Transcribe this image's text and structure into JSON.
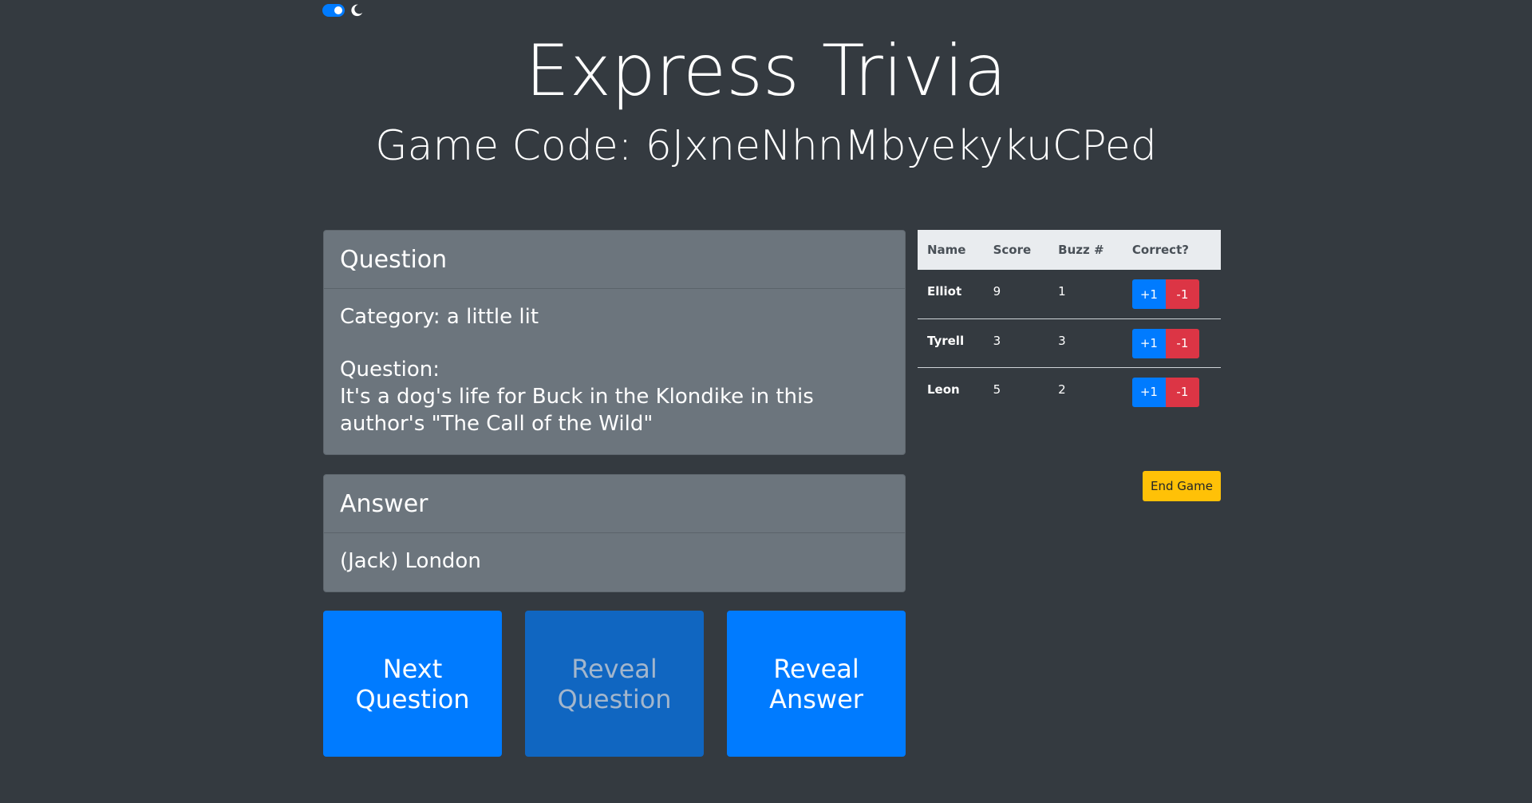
{
  "theme_toggle": {
    "icon": "moon-icon"
  },
  "header": {
    "title": "Express Trivia",
    "game_code": "Game Code: 6JxneNhnMbyekykuCPed"
  },
  "question_card": {
    "header": "Question",
    "category": "Category: a little lit",
    "question_label": "Question:",
    "question_text": "It's a dog's life for Buck in the Klondike in this author's \"The Call of the Wild\""
  },
  "answer_card": {
    "header": "Answer",
    "answer_text": "(Jack) London"
  },
  "actions": {
    "next_question": "Next Question",
    "reveal_question": "Reveal Question",
    "reveal_answer": "Reveal Answer"
  },
  "scoreboard": {
    "columns": [
      "Name",
      "Score",
      "Buzz #",
      "Correct?"
    ],
    "rows": [
      {
        "name": "Elliot",
        "score": "9",
        "buzz": "1"
      },
      {
        "name": "Tyrell",
        "score": "3",
        "buzz": "3"
      },
      {
        "name": "Leon",
        "score": "5",
        "buzz": "2"
      }
    ],
    "plus_label": "+1",
    "minus_label": "-1"
  },
  "end_game_label": "End Game",
  "colors": {
    "background": "#343a40",
    "card": "#6c757d",
    "primary": "#007bff",
    "danger": "#dc3545",
    "warning": "#ffc107",
    "table_header": "#e9ecef"
  }
}
